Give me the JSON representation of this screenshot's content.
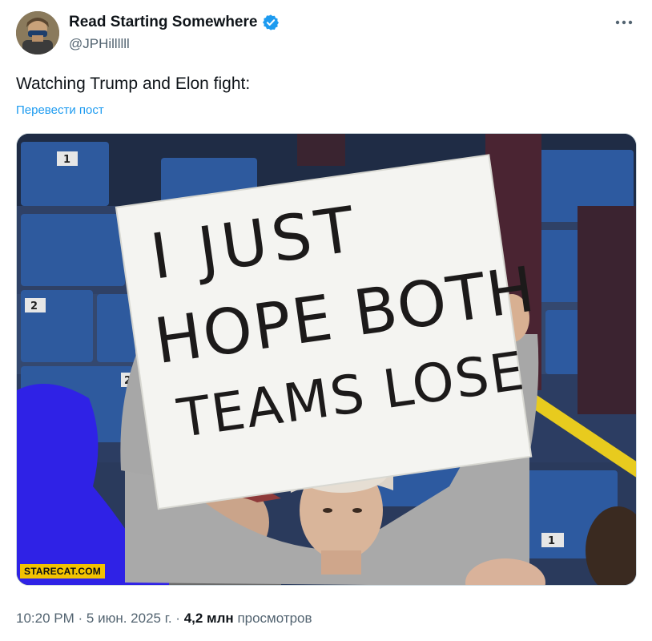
{
  "author": {
    "name": "Read Starting Somewhere",
    "handle": "@JPHillllll",
    "verified": true,
    "avatar_icon": "avatar-photo"
  },
  "post": {
    "text": "Watching Trump and Elon fight:",
    "translate_label": "Перевести пост"
  },
  "media": {
    "sign_lines": [
      "I JUST",
      "HOPE BOTH",
      "TEAMS LOSE"
    ],
    "seat_numbers": [
      "1",
      "2",
      "2",
      "1",
      "1"
    ],
    "watermark": "STARECAT.COM"
  },
  "meta": {
    "time": "10:20 PM",
    "date": "5 июн. 2025 г.",
    "views_count": "4,2 млн",
    "views_label": "просмотров",
    "separator": "·"
  },
  "colors": {
    "link": "#1d9bf0",
    "secondary_text": "#536471",
    "verified_badge": "#1d9bf0"
  }
}
